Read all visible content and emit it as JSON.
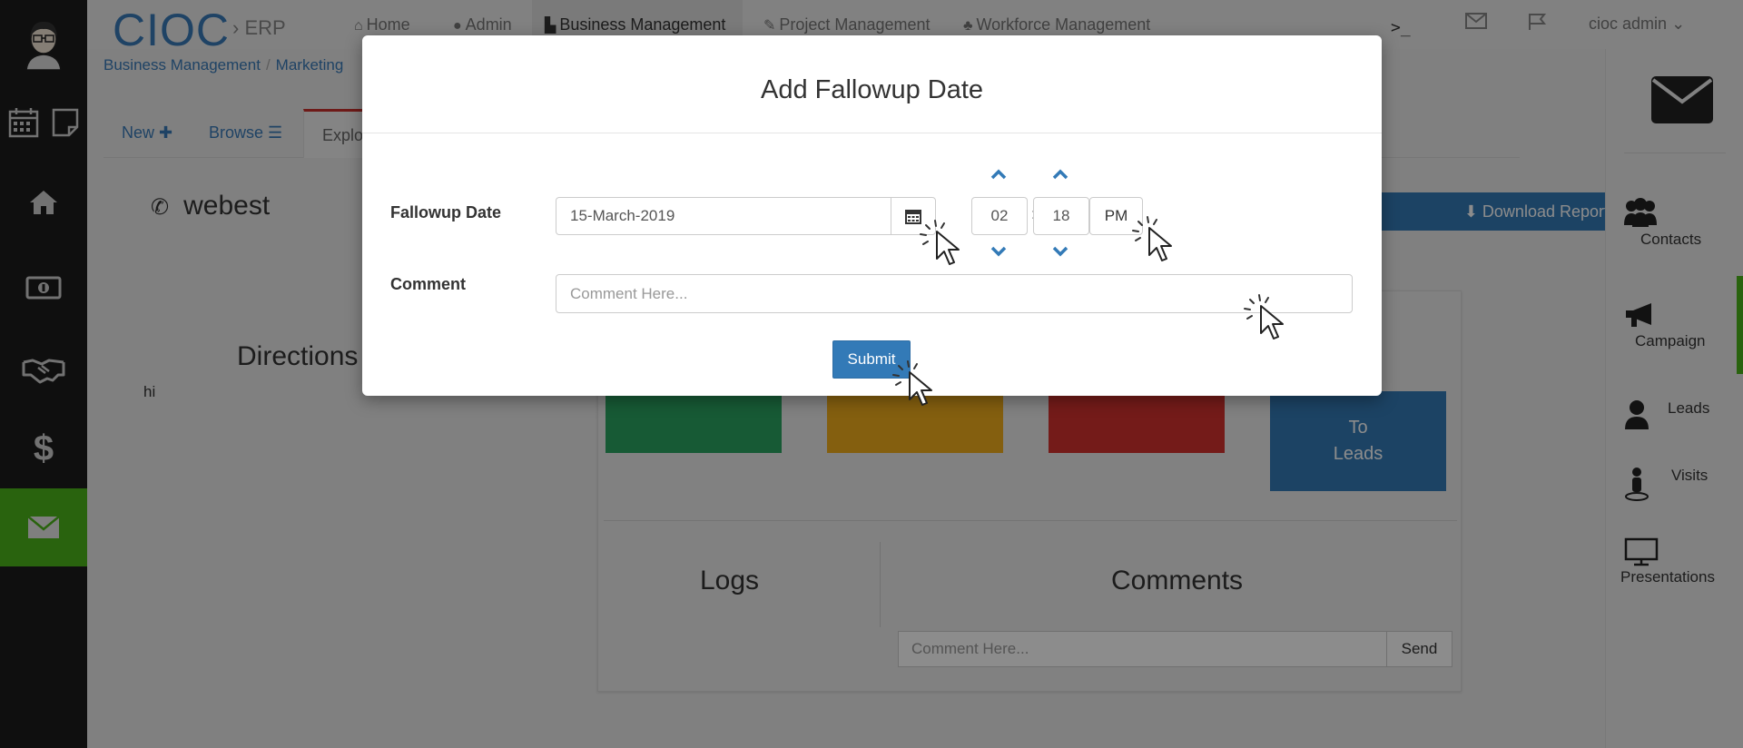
{
  "brand": {
    "name": "CIOC",
    "sub": "ERP"
  },
  "topnav": {
    "items": [
      {
        "label": "Home",
        "icon": "home-icon"
      },
      {
        "label": "Admin",
        "icon": "user-icon"
      },
      {
        "label": "Business Management",
        "icon": "chart-icon",
        "active": true
      },
      {
        "label": "Project Management",
        "icon": "wrench-icon"
      },
      {
        "label": "Workforce Management",
        "icon": "users-icon"
      }
    ],
    "terminal": ">_",
    "user": "cioc admin"
  },
  "breadcrumb": [
    "Business Management",
    "Marketing"
  ],
  "tabs": {
    "new": "New",
    "browse": "Browse",
    "explore": "Explo"
  },
  "lead": {
    "name": "webest"
  },
  "download_report": "Download Report",
  "directions": {
    "title": "Directions",
    "text": "hi"
  },
  "panel": {
    "status_buttons": [
      {
        "color": "#2aa561",
        "label": ""
      },
      {
        "color": "#f0ad1c",
        "label": ""
      },
      {
        "color": "#d3322f",
        "label": ""
      },
      {
        "color": "#337ab7",
        "label_1": "To",
        "label_2": "Leads"
      }
    ],
    "logs_title": "Logs",
    "comments_title": "Comments",
    "comment_placeholder": "Comment Here...",
    "send_label": "Send"
  },
  "right_sidebar": {
    "items": [
      {
        "label": "Contacts",
        "icon": "contacts-icon"
      },
      {
        "label": "Campaign",
        "icon": "megaphone-icon"
      },
      {
        "label": "Leads",
        "icon": "user-icon"
      },
      {
        "label": "Visits",
        "icon": "visitor-icon"
      },
      {
        "label": "Presentations",
        "icon": "monitor-icon"
      }
    ]
  },
  "modal": {
    "title": "Add Fallowup Date",
    "date_label": "Fallowup Date",
    "date_value": "15-March-2019",
    "hour": "02",
    "minute": "18",
    "colon": ":",
    "meridian": "PM",
    "comment_label": "Comment",
    "comment_placeholder": "Comment Here...",
    "submit_label": "Submit"
  },
  "colors": {
    "primary": "#337ab7",
    "sidebar_active": "#4bb51a",
    "sidebar_bg": "#1c1c1c"
  }
}
